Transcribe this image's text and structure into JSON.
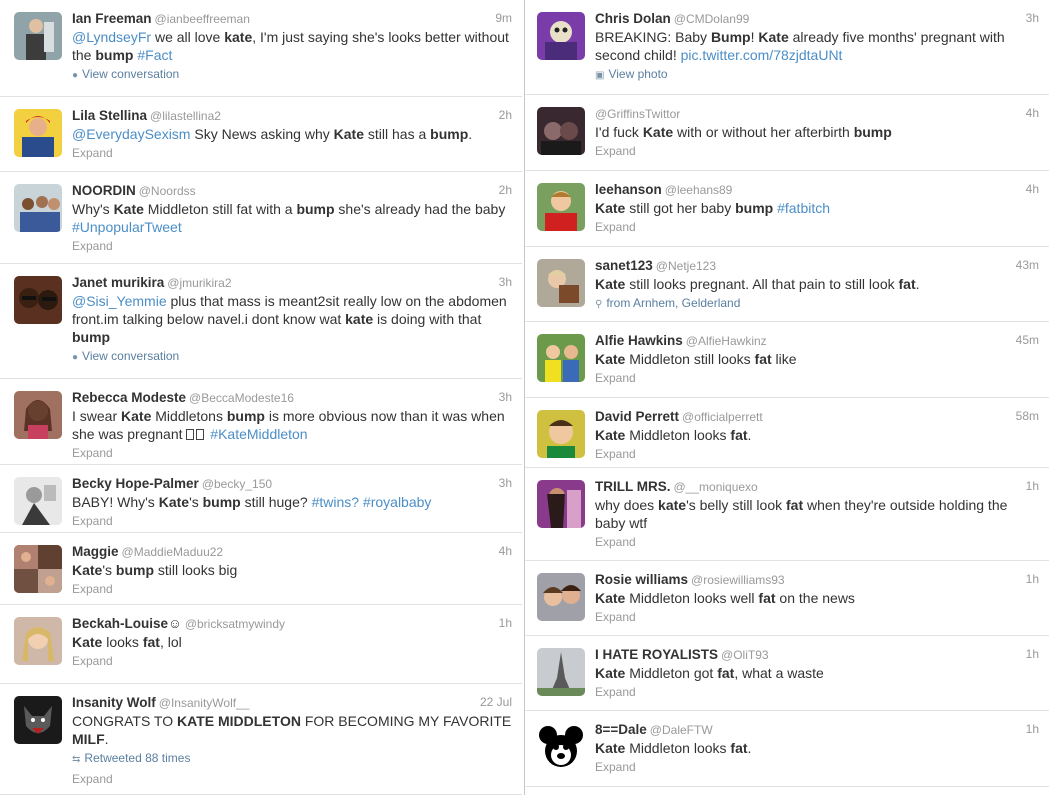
{
  "left": [
    {
      "name": "Ian Freeman",
      "handle": "@ianbeeffreeman",
      "time": "9m",
      "text": [
        {
          "t": "@LyndseyFr",
          "c": "hl"
        },
        {
          "t": " we all love "
        },
        {
          "t": "kate",
          "c": "b"
        },
        {
          "t": ",  I'm just saying she's looks better without the "
        },
        {
          "t": "bump",
          "c": "b"
        },
        {
          "t": " "
        },
        {
          "t": "#Fact",
          "c": "hl"
        }
      ],
      "meta": "View conversation",
      "meta_icon": "speech-bubble-icon",
      "avatar": "av1"
    },
    {
      "name": "Lila Stellina",
      "handle": "@lilastellina2",
      "time": "2h",
      "text": [
        {
          "t": "@EverydaySexism",
          "c": "hl"
        },
        {
          "t": " Sky News asking why "
        },
        {
          "t": "Kate",
          "c": "b"
        },
        {
          "t": " still has a "
        },
        {
          "t": "bump",
          "c": "b"
        },
        {
          "t": "."
        }
      ],
      "meta": "Expand",
      "avatar": "av2"
    },
    {
      "name": "NOORDIN",
      "handle": "@Noordss",
      "time": "2h",
      "text": [
        {
          "t": "Why's "
        },
        {
          "t": "Kate",
          "c": "b"
        },
        {
          "t": " Middleton still fat with a "
        },
        {
          "t": "bump",
          "c": "b"
        },
        {
          "t": " she's already had the baby "
        },
        {
          "t": "#UnpopularTweet",
          "c": "hl"
        }
      ],
      "meta": "Expand",
      "avatar": "av3"
    },
    {
      "name": "Janet murikira",
      "handle": "@jmurikira2",
      "time": "3h",
      "text": [
        {
          "t": "@Sisi_Yemmie",
          "c": "hl"
        },
        {
          "t": " plus that mass is meant2sit really low on the abdomen front.im talking below navel.i dont know wat "
        },
        {
          "t": "kate",
          "c": "b"
        },
        {
          "t": " is doing with that "
        },
        {
          "t": "bump",
          "c": "b"
        }
      ],
      "meta": "View conversation",
      "meta_icon": "speech-bubble-icon",
      "avatar": "av4"
    },
    {
      "name": "Rebecca Modeste",
      "handle": "@BeccaModeste16",
      "time": "3h",
      "text": [
        {
          "t": "I swear "
        },
        {
          "t": "Kate",
          "c": "b"
        },
        {
          "t": " Middletons "
        },
        {
          "t": "bump",
          "c": "b"
        },
        {
          "t": " is more obvious now than it was when she was pregnant "
        },
        {
          "t": "EMOJI"
        },
        {
          "t": " "
        },
        {
          "t": "#KateMiddleton",
          "c": "hl"
        }
      ],
      "meta": "Expand",
      "avatar": "av5"
    },
    {
      "name": "Becky Hope-Palmer",
      "handle": "@becky_150",
      "time": "3h",
      "text": [
        {
          "t": "BABY! Why's "
        },
        {
          "t": "Kate",
          "c": "b"
        },
        {
          "t": "'s "
        },
        {
          "t": "bump",
          "c": "b"
        },
        {
          "t": " still huge? "
        },
        {
          "t": "#twins?",
          "c": "hl"
        },
        {
          "t": " "
        },
        {
          "t": "#royalbaby",
          "c": "hl"
        }
      ],
      "meta": "Expand",
      "avatar": "av6"
    },
    {
      "name": "Maggie",
      "handle": "@MaddieMaduu22",
      "time": "4h",
      "text": [
        {
          "t": "Kate",
          "c": "b"
        },
        {
          "t": "'s "
        },
        {
          "t": "bump",
          "c": "b"
        },
        {
          "t": " still looks big"
        }
      ],
      "meta": "Expand",
      "avatar": "av7"
    },
    {
      "name": "Beckah-Louise",
      "name_suffix": "☺",
      "handle": "@bricksatmywindy",
      "time": "1h",
      "text": [
        {
          "t": "Kate",
          "c": "b"
        },
        {
          "t": " looks "
        },
        {
          "t": "fat",
          "c": "b"
        },
        {
          "t": ", lol"
        }
      ],
      "meta": "Expand",
      "avatar": "av8"
    },
    {
      "name": "Insanity Wolf",
      "handle": "@InsanityWolf__",
      "time": "22 Jul",
      "text": [
        {
          "t": "CONGRATS TO "
        },
        {
          "t": "KATE MIDDLETON",
          "c": "b"
        },
        {
          "t": " FOR BECOMING MY FAVORITE "
        },
        {
          "t": "MILF",
          "c": "b"
        },
        {
          "t": "."
        }
      ],
      "meta": "Retweeted 88 times",
      "meta_icon": "retweet-icon",
      "meta2": "Expand",
      "avatar": "av9"
    }
  ],
  "right": [
    {
      "name": "Chris Dolan",
      "handle": "@CMDolan99",
      "time": "3h",
      "text": [
        {
          "t": "BREAKING: Baby "
        },
        {
          "t": "Bump",
          "c": "b"
        },
        {
          "t": "! "
        },
        {
          "t": "Kate",
          "c": "b"
        },
        {
          "t": " already five months' pregnant with second child! "
        },
        {
          "t": "pic.twitter.com/78zjdtaUNt",
          "c": "hl"
        }
      ],
      "meta": "View photo",
      "meta_icon": "photo-icon",
      "avatar": "av10"
    },
    {
      "name": "",
      "handle": "@GriffinsTwittor",
      "time": "4h",
      "text": [
        {
          "t": "I'd fuck "
        },
        {
          "t": "Kate",
          "c": "b"
        },
        {
          "t": " with or without her afterbirth "
        },
        {
          "t": "bump",
          "c": "b"
        }
      ],
      "meta": "Expand",
      "avatar": "av11"
    },
    {
      "name": "leehanson",
      "handle": "@leehans89",
      "time": "4h",
      "text": [
        {
          "t": "Kate",
          "c": "b"
        },
        {
          "t": " still got her baby "
        },
        {
          "t": "bump",
          "c": "b"
        },
        {
          "t": " "
        },
        {
          "t": "#fatbitch",
          "c": "hl"
        }
      ],
      "meta": "Expand",
      "avatar": "av12"
    },
    {
      "name": "sanet123",
      "handle": "@Netje123",
      "time": "43m",
      "text": [
        {
          "t": "Kate",
          "c": "b"
        },
        {
          "t": " still looks pregnant. All that pain to still look "
        },
        {
          "t": "fat",
          "c": "b"
        },
        {
          "t": "."
        }
      ],
      "meta": "from Arnhem, Gelderland",
      "meta_icon": "location-pin-icon",
      "avatar": "av13"
    },
    {
      "name": "Alfie Hawkins",
      "handle": "@AlfieHawkinz",
      "time": "45m",
      "text": [
        {
          "t": "Kate",
          "c": "b"
        },
        {
          "t": " Middleton still looks "
        },
        {
          "t": "fat",
          "c": "b"
        },
        {
          "t": " like"
        }
      ],
      "meta": "Expand",
      "avatar": "av14"
    },
    {
      "name": "David Perrett",
      "handle": "@officialperrett",
      "time": "58m",
      "text": [
        {
          "t": "Kate",
          "c": "b"
        },
        {
          "t": " Middleton looks "
        },
        {
          "t": "fat",
          "c": "b"
        },
        {
          "t": "."
        }
      ],
      "meta": "Expand",
      "avatar": "av15"
    },
    {
      "name": "TRILL MRS.",
      "handle": "@__moniquexo",
      "time": "1h",
      "text": [
        {
          "t": "why does "
        },
        {
          "t": "kate",
          "c": "b"
        },
        {
          "t": "'s belly still look "
        },
        {
          "t": "fat",
          "c": "b"
        },
        {
          "t": " when they're outside holding the baby wtf"
        }
      ],
      "meta": "Expand",
      "avatar": "av16"
    },
    {
      "name": "Rosie williams",
      "handle": "@rosiewilliams93",
      "time": "1h",
      "text": [
        {
          "t": "Kate",
          "c": "b"
        },
        {
          "t": " Middleton looks well "
        },
        {
          "t": "fat",
          "c": "b"
        },
        {
          "t": " on the news"
        }
      ],
      "meta": "Expand",
      "avatar": "av17"
    },
    {
      "name": "I HATE ROYALISTS",
      "handle": "@OliT93",
      "time": "1h",
      "text": [
        {
          "t": "Kate",
          "c": "b"
        },
        {
          "t": " Middleton got "
        },
        {
          "t": "fat",
          "c": "b"
        },
        {
          "t": ", what a waste"
        }
      ],
      "meta": "Expand",
      "avatar": "av18"
    },
    {
      "name": "8==Dale",
      "handle": "@DaleFTW",
      "time": "1h",
      "text": [
        {
          "t": "Kate",
          "c": "b"
        },
        {
          "t": " Middleton looks "
        },
        {
          "t": "fat",
          "c": "b"
        },
        {
          "t": "."
        }
      ],
      "meta": "Expand",
      "avatar": "av19"
    }
  ]
}
